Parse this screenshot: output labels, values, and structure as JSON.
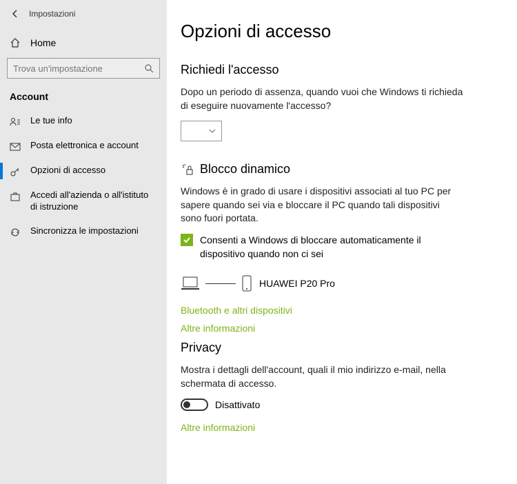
{
  "app": {
    "title": "Impostazioni"
  },
  "sidebar": {
    "home": "Home",
    "search_placeholder": "Trova un'impostazione",
    "section": "Account",
    "items": [
      {
        "label": "Le tue info"
      },
      {
        "label": "Posta elettronica e account"
      },
      {
        "label": "Opzioni di accesso"
      },
      {
        "label": "Accedi all'azienda o all'istituto di istruzione"
      },
      {
        "label": "Sincronizza le impostazioni"
      }
    ]
  },
  "main": {
    "title": "Opzioni di accesso",
    "require": {
      "title": "Richiedi l'accesso",
      "text": "Dopo un periodo di assenza, quando vuoi che Windows ti richieda di eseguire nuovamente l'accesso?",
      "value": ""
    },
    "dynamic": {
      "title": "Blocco dinamico",
      "text": "Windows è in grado di usare i dispositivi associati al tuo PC per sapere quando sei via e bloccare il PC quando tali dispositivi sono fuori portata.",
      "checkbox_label": "Consenti a Windows di bloccare automaticamente il dispositivo quando non ci sei",
      "checked": true,
      "device": "HUAWEI P20 Pro",
      "link_bt": "Bluetooth e altri dispositivi",
      "link_more": "Altre informazioni"
    },
    "privacy": {
      "title": "Privacy",
      "text": "Mostra i dettagli dell'account, quali il mio indirizzo e-mail, nella schermata di accesso.",
      "toggle_state": "Disattivato",
      "link_more": "Altre informazioni"
    }
  }
}
